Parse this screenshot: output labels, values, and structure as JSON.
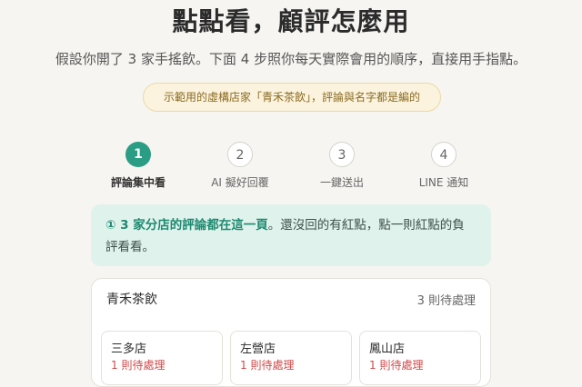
{
  "page": {
    "title": "點點看，顧評怎麼用",
    "subtitle": "假設你開了 3 家手搖飲。下面 4 步照你每天實際會用的順序，直接用手指點。",
    "note": "示範用的虛構店家「青禾茶飲」，評論與名字都是編的"
  },
  "steps": [
    {
      "number": "1",
      "label": "評論集中看"
    },
    {
      "number": "2",
      "label": "AI 擬好回覆"
    },
    {
      "number": "3",
      "label": "一鍵送出"
    },
    {
      "number": "4",
      "label": "LINE 通知"
    }
  ],
  "hint": {
    "prefix": "① ",
    "highlight": "3 家分店的評論都在這一頁",
    "rest": "。還沒回的有紅點，點一則紅點的負評看看。"
  },
  "store": {
    "name": "青禾茶飲",
    "pending": "3 則待處理",
    "branches": [
      {
        "name": "三多店",
        "count": "1 則待處理"
      },
      {
        "name": "左營店",
        "count": "1 則待處理"
      },
      {
        "name": "鳳山店",
        "count": "1 則待處理"
      }
    ]
  }
}
